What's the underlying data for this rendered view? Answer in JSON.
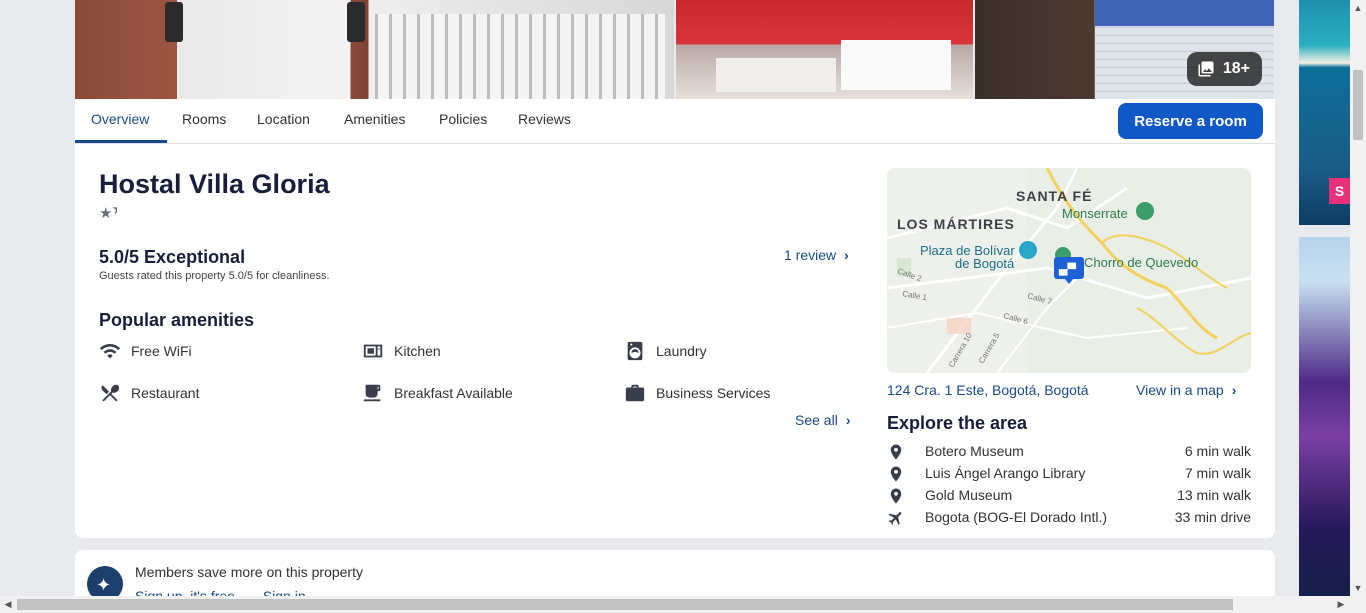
{
  "gallery": {
    "photo_count": "18+",
    "icon": "photo-gallery-icon"
  },
  "nav": {
    "tabs": [
      {
        "label": "Overview",
        "active": true
      },
      {
        "label": "Rooms"
      },
      {
        "label": "Location"
      },
      {
        "label": "Amenities"
      },
      {
        "label": "Policies"
      },
      {
        "label": "Reviews"
      }
    ],
    "reserve_label": "Reserve a room"
  },
  "property": {
    "name": "Hostal Villa Gloria",
    "star_rating": 1.5,
    "rating_headline": "5.0/5 Exceptional",
    "rating_sub": "Guests rated this property 5.0/5 for cleanliness.",
    "review_link": "1 review"
  },
  "amenities": {
    "title": "Popular amenities",
    "items": [
      {
        "label": "Free WiFi",
        "icon": "wifi-icon"
      },
      {
        "label": "Kitchen",
        "icon": "kitchen-icon"
      },
      {
        "label": "Laundry",
        "icon": "laundry-icon"
      },
      {
        "label": "Restaurant",
        "icon": "restaurant-icon"
      },
      {
        "label": "Breakfast Available",
        "icon": "coffee-icon"
      },
      {
        "label": "Business Services",
        "icon": "briefcase-icon"
      }
    ],
    "see_all": "See all"
  },
  "location": {
    "map_labels": {
      "santa_fe": "SANTA FÉ",
      "monserrate": "Monserrate",
      "los_martires": "LOS MÁRTIRES",
      "plaza_line1": "Plaza de Bolívar",
      "plaza_line2": "de Bogotá",
      "chorro": "Chorro de Quevedo",
      "calle2": "Calle 2",
      "calle1": "Calle 1",
      "calle7": "Calle 7",
      "calle6": "Calle 6",
      "carrera10": "Carrera 10",
      "carrera5": "Carrera 5"
    },
    "address": "124 Cra. 1 Este, Bogotá, Bogotá",
    "map_link": "View in a map"
  },
  "explore": {
    "title": "Explore the area",
    "items": [
      {
        "name": "Botero Museum",
        "distance": "6 min walk",
        "icon": "location-pin-icon"
      },
      {
        "name": "Luis Ángel Arango Library",
        "distance": "7 min walk",
        "icon": "location-pin-icon"
      },
      {
        "name": "Gold Museum",
        "distance": "13 min walk",
        "icon": "location-pin-icon"
      },
      {
        "name": "Bogota (BOG-El Dorado Intl.)",
        "distance": "33 min drive",
        "icon": "airplane-icon"
      }
    ]
  },
  "members": {
    "text": "Members save more on this property",
    "signup": "Sign up, it's free",
    "signin": "Sign in"
  },
  "ads": {
    "badge_text": "S"
  },
  "colors": {
    "accent": "#1158c7",
    "link": "#1b4a8c",
    "map_marker": "#1e60d6",
    "text": "#191e3b"
  }
}
